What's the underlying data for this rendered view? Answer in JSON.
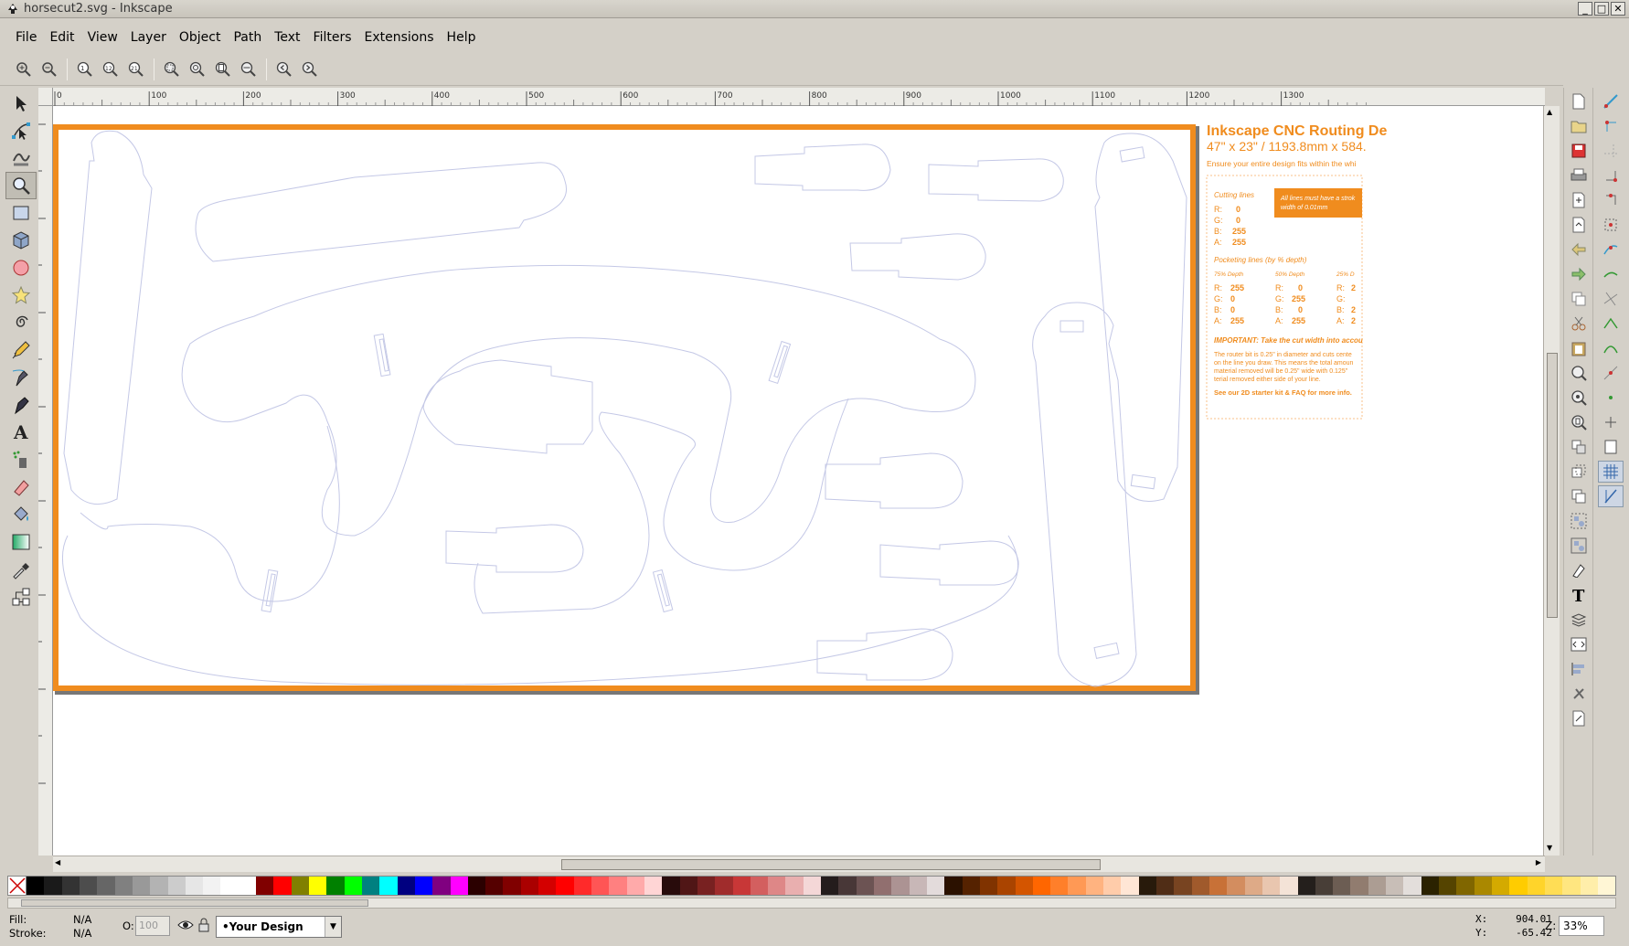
{
  "window": {
    "title": "horsecut2.svg - Inkscape",
    "min": "_",
    "max": "□",
    "close": "✕"
  },
  "menu": [
    "File",
    "Edit",
    "View",
    "Layer",
    "Object",
    "Path",
    "Text",
    "Filters",
    "Extensions",
    "Help"
  ],
  "ruler": {
    "labels": [
      "0",
      "100",
      "200",
      "300",
      "400",
      "500",
      "600",
      "700",
      "800",
      "900",
      "1000",
      "1100",
      "1200",
      "1300"
    ]
  },
  "info_panel": {
    "title": "Inkscape CNC Routing De",
    "dims": "47\" x 23\" / 1193.8mm x 584.",
    "note": "Ensure your entire design fits within the whi",
    "cutting_heading": "Cutting lines",
    "stroke_note_1": "All lines must have a strok",
    "stroke_note_2": "width of 0.01mm",
    "cut_rows": [
      [
        "R:",
        "0"
      ],
      [
        "G:",
        "0"
      ],
      [
        "B:",
        "255"
      ],
      [
        "A:",
        "255"
      ]
    ],
    "pocket_heading": "Pocketing lines (by % depth)",
    "depth_headers": [
      "75% Depth",
      "50% Depth",
      "25% D"
    ],
    "pocket_cols": [
      [
        [
          "R:",
          "255"
        ],
        [
          "G:",
          "0"
        ],
        [
          "B:",
          "0"
        ],
        [
          "A:",
          "255"
        ]
      ],
      [
        [
          "R:",
          "0"
        ],
        [
          "G:",
          "255"
        ],
        [
          "B:",
          "0"
        ],
        [
          "A:",
          "255"
        ]
      ],
      [
        [
          "R:",
          "2"
        ],
        [
          "G:",
          ""
        ],
        [
          "B:",
          "2"
        ],
        [
          "A:",
          "2"
        ]
      ]
    ],
    "important": "IMPORTANT: Take the cut width into accou",
    "router_1": "The router bit is 0.25\" in diameter and cuts cente",
    "router_2": "on the line you draw. This means the total amoun",
    "router_3": "material removed will be 0.25\" wide with 0.125\"",
    "router_4": "terial removed either side of your line.",
    "faq": "See our 2D starter kit & FAQ for more info."
  },
  "status": {
    "fill_label": "Fill:",
    "fill_value": "N/A",
    "stroke_label": "Stroke:",
    "stroke_value": "N/A",
    "opacity_label": "O:",
    "opacity_value": "100",
    "layer": "•Your Design",
    "x_label": "X:",
    "x_value": "904.01",
    "y_label": "Y:",
    "y_value": "-65.42",
    "zoom_label": "Z:",
    "zoom_value": "33%"
  },
  "colors": {
    "border": "#f08c1e",
    "accent": "#f08c1e",
    "palette": [
      "#000000",
      "#1a1a1a",
      "#333333",
      "#4d4d4d",
      "#666666",
      "#808080",
      "#999999",
      "#b3b3b3",
      "#cccccc",
      "#e6e6e6",
      "#f2f2f2",
      "#ffffff",
      "#ffffff",
      "#800000",
      "#ff0000",
      "#808000",
      "#ffff00",
      "#008000",
      "#00ff00",
      "#008080",
      "#00ffff",
      "#000080",
      "#0000ff",
      "#800080",
      "#ff00ff",
      "#2b0000",
      "#550000",
      "#800000",
      "#aa0000",
      "#d40000",
      "#ff0000",
      "#ff2a2a",
      "#ff5555",
      "#ff8080",
      "#ffaaaa",
      "#ffd5d5",
      "#280b0b",
      "#501616",
      "#782121",
      "#a02c2c",
      "#c83737",
      "#d35f5f",
      "#de8787",
      "#e9afaf",
      "#f4d7d7",
      "#241c1c",
      "#483737",
      "#6c5353",
      "#916f6f",
      "#ac9393",
      "#c8b7b7",
      "#e3dbdb",
      "#2b1100",
      "#552200",
      "#803300",
      "#aa4400",
      "#d45500",
      "#ff6600",
      "#ff7f2a",
      "#ff9955",
      "#ffb380",
      "#ffccaa",
      "#ffe6d5",
      "#281a0b",
      "#502d16",
      "#784421",
      "#a05a2c",
      "#c87137",
      "#d38d5f",
      "#deaa87",
      "#e9c6af",
      "#f4e3d7",
      "#241f1c",
      "#483e37",
      "#6c5d53",
      "#917c6f",
      "#ac9d93",
      "#c8beb7",
      "#e3dedb",
      "#2b2200",
      "#554400",
      "#806600",
      "#aa8800",
      "#d4aa00",
      "#ffcc00",
      "#ffd42a",
      "#ffdd55",
      "#ffe680",
      "#ffeeaa",
      "#fff6d5"
    ]
  }
}
